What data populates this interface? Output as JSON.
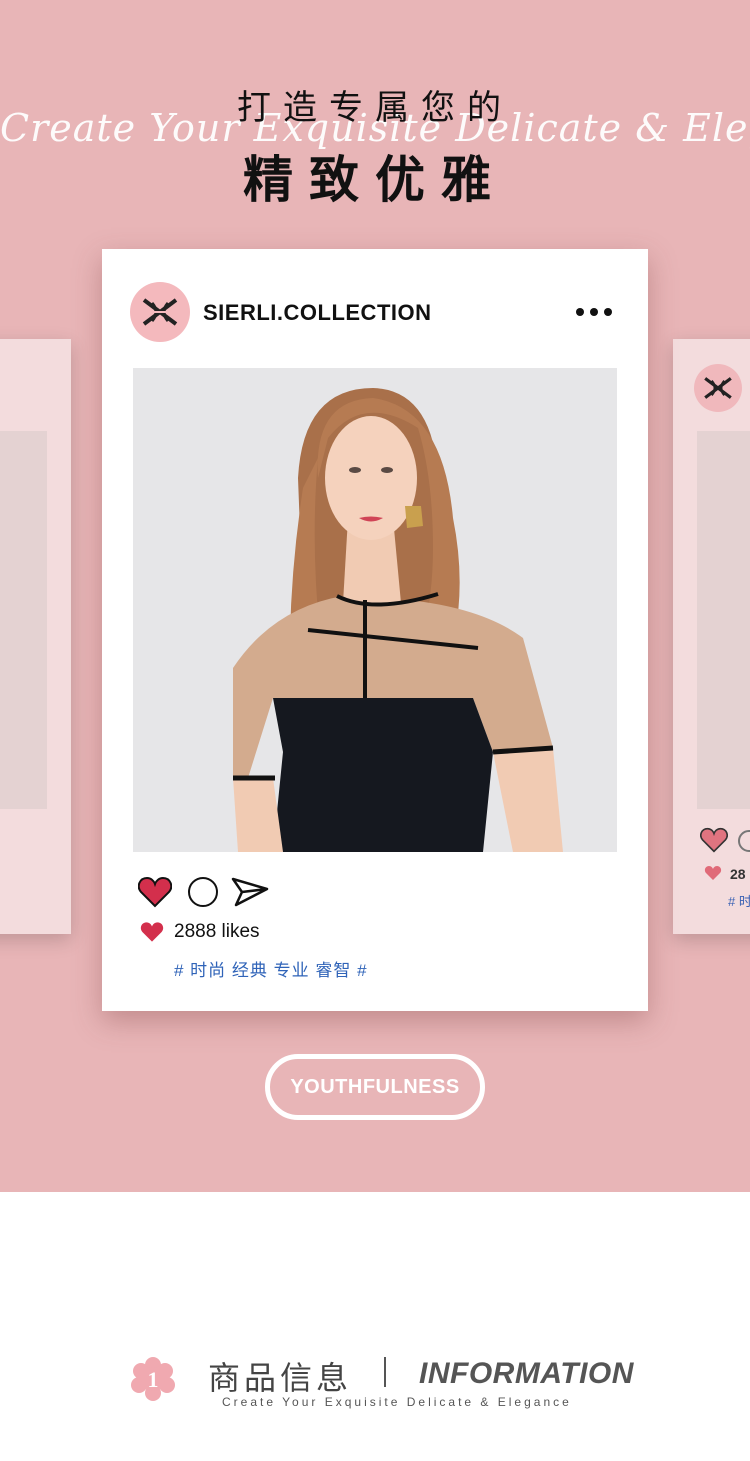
{
  "headline": {
    "cn_line1": "打造专属您的",
    "cn_line2": "精致优雅",
    "script": "Create Your Exquisite Delicate & Elegance"
  },
  "post": {
    "username": "SIERLI.COLLECTION",
    "likes": "2888 likes",
    "hashtags": "# 时尚 经典 专业 睿智 #"
  },
  "ghost_card": {
    "likes": "28",
    "tags": "# 时"
  },
  "pill_label": "YOUTHFULNESS",
  "info": {
    "number": "1",
    "cn": "商品信息",
    "en": "INFORMATION",
    "sub": "Create Your Exquisite Delicate & Elegance"
  },
  "colors": {
    "background": "#e8b5b7",
    "like_red": "#d32f4c",
    "hashtag_blue": "#2f63b8"
  },
  "icons": [
    "brand-logo-icon",
    "more-icon",
    "heart-icon",
    "comment-icon",
    "share-icon",
    "flower-number-icon"
  ]
}
